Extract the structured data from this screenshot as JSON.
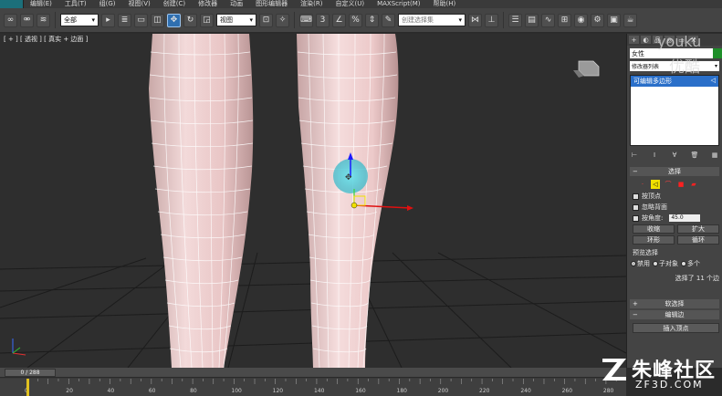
{
  "menubar": {
    "items": [
      "编辑(E)",
      "工具(T)",
      "组(G)",
      "视图(V)",
      "创建(C)",
      "修改器",
      "动画",
      "图形编辑器",
      "渲染(R)",
      "自定义(U)",
      "MAXScript(M)",
      "帮助(H)"
    ]
  },
  "toolbar": {
    "filter_value": "全部",
    "coord_value": "视图",
    "named_selection_placeholder": "创建选择集"
  },
  "viewport": {
    "label": "[ + ] [ 透视 ] [ 真实 + 边面 ]"
  },
  "command_panel": {
    "tabs": [
      "+",
      "◐",
      "品",
      "◎",
      "▭",
      "⚒"
    ],
    "object_name": "女性",
    "modifier_list": "修改器列表",
    "stack_item": "可编辑多边形",
    "selection_rollout": "选择",
    "by_vertex": "按顶点",
    "ignore_backfacing": "忽略背面",
    "by_angle": "按角度:",
    "angle_value": "45.0",
    "shrink": "收缩",
    "grow": "扩大",
    "ring": "环形",
    "loop": "循环",
    "preview_selection": "预览选择",
    "radio_disabled": "禁用",
    "radio_subobject": "子对象",
    "radio_multi": "多个",
    "selection_status": "选择了 11 个边",
    "soft_selection_rollout": "软选择",
    "edit_edges_rollout": "编辑边",
    "insert_vertex": "插入顶点"
  },
  "timeline": {
    "frame_display": "0 / 288",
    "ticks": [
      "0",
      "20",
      "40",
      "60",
      "80",
      "100",
      "120",
      "140",
      "160",
      "180",
      "200",
      "220",
      "240",
      "260",
      "280"
    ]
  },
  "watermarks": {
    "youku": "youku",
    "youku_cn": "优酷",
    "site_cn": "朱峰社区",
    "site_url": "ZF3D.COM"
  },
  "colors": {
    "selection_blue": "#2a6fc9",
    "active_yellow": "#f0e000",
    "gizmo_cyan": "#49c7d6"
  }
}
